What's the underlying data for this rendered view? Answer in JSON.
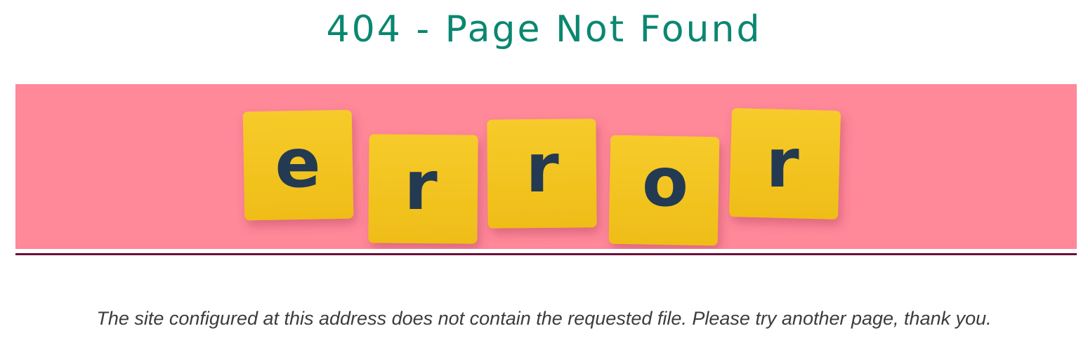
{
  "page": {
    "title": "404 - Page Not Found",
    "message": "The site configured at this address does not contain the requested file. Please try another page, thank you."
  },
  "banner": {
    "tiles": [
      "e",
      "r",
      "r",
      "o",
      "r"
    ]
  },
  "colors": {
    "title": "#0a8770",
    "banner_background": "#ff8899",
    "tile": "#f2c21e",
    "tile_letter": "#233a52",
    "divider": "#6b0f3a",
    "message": "#3c3c3c"
  }
}
